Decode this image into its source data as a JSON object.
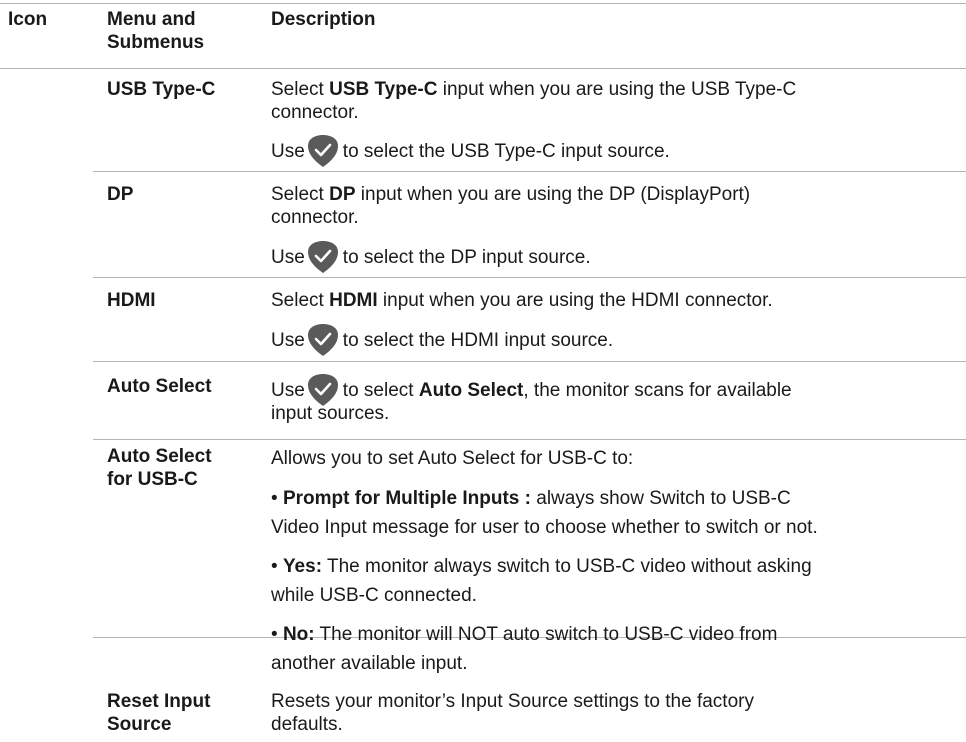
{
  "header": {
    "icon": "Icon",
    "menu_line1": "Menu and",
    "menu_line2": "Submenus",
    "description": "Description"
  },
  "rows": {
    "usbc": {
      "name": "USB Type-C",
      "desc1_pre": "Select ",
      "desc1_bold": "USB Type-C",
      "desc1_post": " input when you are using the USB Type-C",
      "desc1_line2": "connector.",
      "use_pre": "Use",
      "use_post": "to select the USB Type-C input source."
    },
    "dp": {
      "name": "DP",
      "desc1_pre": "Select ",
      "desc1_bold": "DP",
      "desc1_post": " input when you are using the DP (DisplayPort)",
      "desc1_line2": "connector.",
      "use_pre": "Use",
      "use_post": "to select the DP input source."
    },
    "hdmi": {
      "name": "HDMI",
      "desc1_pre": "Select ",
      "desc1_bold": "HDMI",
      "desc1_post": " input when you are using the HDMI connector.",
      "use_pre": "Use",
      "use_post": "to select the HDMI input source."
    },
    "auto": {
      "name": "Auto Select",
      "use_pre": "Use",
      "use_mid": "to select ",
      "use_bold": "Auto Select",
      "use_post": ", the monitor scans for available",
      "line2": "input sources."
    },
    "autousbc": {
      "name_line1": "Auto Select",
      "name_line2": "for USB-C",
      "intro": "Allows you to set Auto Select for USB-C to:",
      "bullet": "•",
      "opt1_bold": "Prompt for Multiple Inputs :",
      "opt1_text": " always show Switch to USB-C",
      "opt1_line2": "Video Input message for user to choose whether to switch or not.",
      "opt2_bold": "Yes:",
      "opt2_text": " The monitor always switch to USB-C video without asking",
      "opt2_line2": "while USB-C connected.",
      "opt3_bold": "No:",
      "opt3_text": " The monitor  will NOT auto switch to USB-C video from",
      "opt3_line2": "another available input."
    },
    "reset": {
      "name_line1": "Reset Input",
      "name_line2": "Source",
      "desc_line1": "Resets your monitor’s Input Source settings to the factory",
      "desc_line2": "defaults."
    }
  },
  "icon": {
    "name": "checkmark-shield-icon",
    "color": "#5a5a5a"
  }
}
